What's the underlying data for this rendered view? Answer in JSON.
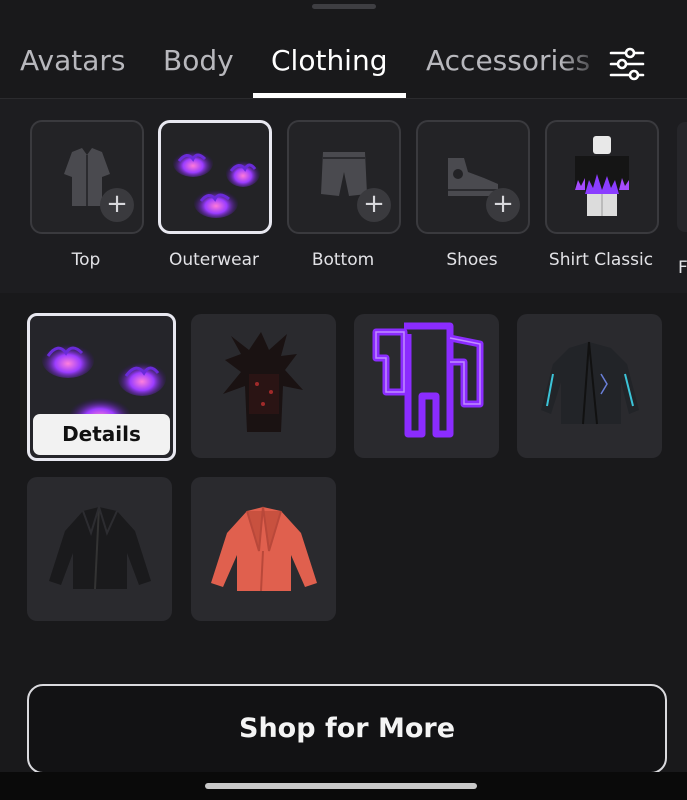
{
  "tabs": [
    {
      "label": "Avatars"
    },
    {
      "label": "Body"
    },
    {
      "label": "Clothing",
      "active": true
    },
    {
      "label": "Accessories"
    }
  ],
  "filter_icon": "sliders-icon",
  "categories": [
    {
      "label": "Top",
      "icon": "shirt-icon",
      "has_plus": true
    },
    {
      "label": "Outerwear",
      "icon": "purple-fire-thumbnail",
      "selected": true
    },
    {
      "label": "Bottom",
      "icon": "shorts-icon",
      "has_plus": true
    },
    {
      "label": "Shoes",
      "icon": "sneaker-icon",
      "has_plus": true
    },
    {
      "label": "Shirt Classic",
      "icon": "classic-shirt-thumbnail"
    }
  ],
  "items": [
    {
      "name": "purple-fire-outerwear",
      "selected": true,
      "action_label": "Details"
    },
    {
      "name": "dark-spiked-armor"
    },
    {
      "name": "purple-neon-outline-shirt"
    },
    {
      "name": "black-neon-jacket"
    },
    {
      "name": "black-leather-jacket"
    },
    {
      "name": "coral-blazer"
    }
  ],
  "shop_button": {
    "label": "Shop for More"
  },
  "colors": {
    "background": "#19191b",
    "tile": "#2a2a2e",
    "accent_purple": "#8b3dff",
    "coral": "#e0604e"
  }
}
